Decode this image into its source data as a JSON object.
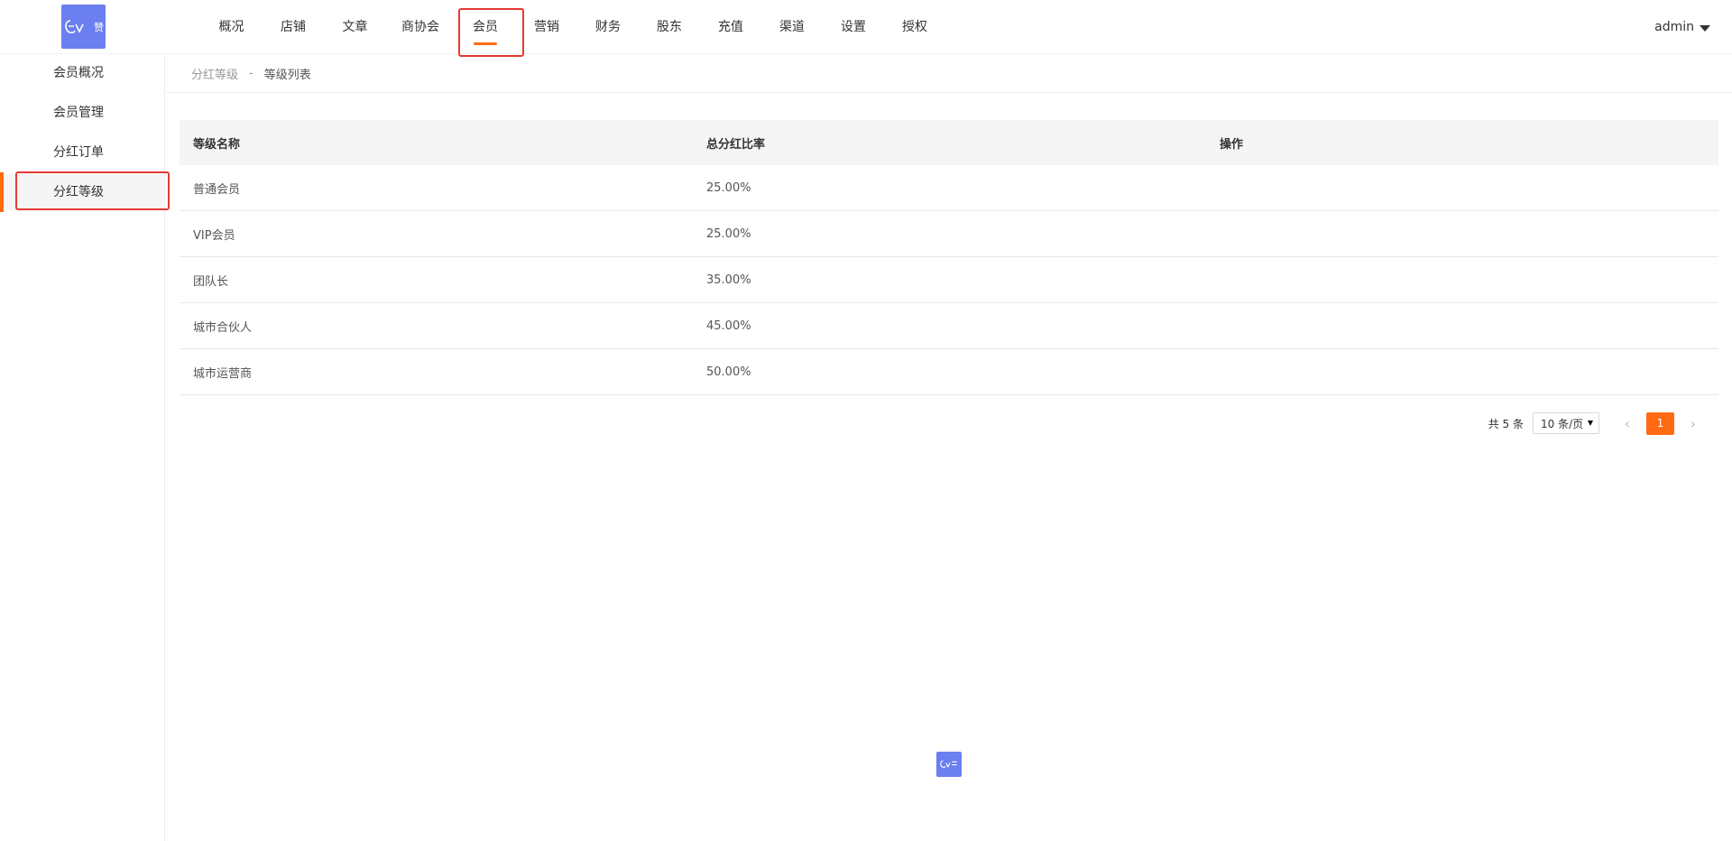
{
  "brand": {
    "logo_text": "赞",
    "accent_color": "#ff6a13",
    "logo_color": "#6b7ff0",
    "highlight_color": "#e53935"
  },
  "topnav": {
    "items": [
      {
        "label": "概况"
      },
      {
        "label": "店铺"
      },
      {
        "label": "文章"
      },
      {
        "label": "商协会"
      },
      {
        "label": "会员",
        "active": true
      },
      {
        "label": "营销"
      },
      {
        "label": "财务"
      },
      {
        "label": "股东"
      },
      {
        "label": "充值"
      },
      {
        "label": "渠道"
      },
      {
        "label": "设置"
      },
      {
        "label": "授权"
      }
    ]
  },
  "user": {
    "name": "admin",
    "icon": "caret-down-icon"
  },
  "sidebar": {
    "items": [
      {
        "label": "会员概况"
      },
      {
        "label": "会员管理"
      },
      {
        "label": "分红订单"
      },
      {
        "label": "分红等级",
        "active": true
      }
    ]
  },
  "breadcrumb": {
    "parent": "分红等级",
    "separator": "-",
    "current": "等级列表"
  },
  "table": {
    "headers": {
      "name": "等级名称",
      "rate": "总分红比率",
      "op": "操作"
    },
    "rows": [
      {
        "name": "普通会员",
        "rate": "25.00%"
      },
      {
        "name": "VIP会员",
        "rate": "25.00%"
      },
      {
        "name": "团队长",
        "rate": "35.00%"
      },
      {
        "name": "城市合伙人",
        "rate": "45.00%"
      },
      {
        "name": "城市运营商",
        "rate": "50.00%"
      }
    ]
  },
  "pagination": {
    "total": "共 5 条",
    "page_size": "10 条/页",
    "current_page": "1",
    "prev_icon": "chevron-left-icon",
    "next_icon": "chevron-right-icon"
  }
}
